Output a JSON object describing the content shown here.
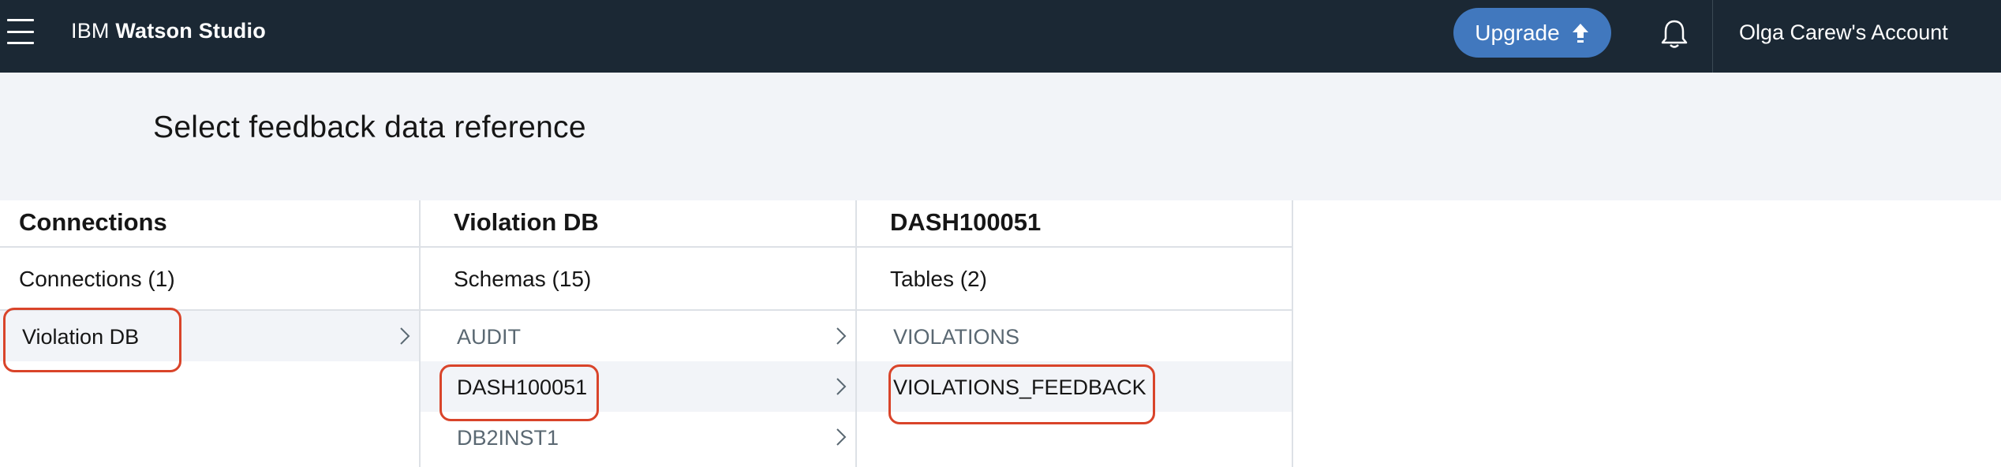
{
  "topbar": {
    "brand_prefix": "IBM",
    "brand_product": "Watson Studio",
    "upgrade_label": "Upgrade",
    "account_label": "Olga Carew's Account"
  },
  "header": {
    "title": "Select feedback data reference"
  },
  "columns": [
    {
      "title": "Connections",
      "subtitle": "Connections (1)",
      "items": [
        "Violation DB"
      ],
      "selected_index": 0
    },
    {
      "title": "Violation DB",
      "subtitle": "Schemas (15)",
      "items": [
        "AUDIT",
        "DASH100051",
        "DB2INST1"
      ],
      "selected_index": 1
    },
    {
      "title": "DASH100051",
      "subtitle": "Tables (2)",
      "items": [
        "VIOLATIONS",
        "VIOLATIONS_FEEDBACK"
      ],
      "selected_index": 1
    }
  ],
  "colors": {
    "topbar_bg": "#1b2834",
    "upgrade_bg": "#4178be",
    "header_bg": "#f2f4f8",
    "highlight_outline": "#d9442a"
  },
  "icons": [
    "menu-icon",
    "upload-arrow-icon",
    "bell-icon",
    "chevron-right-icon"
  ]
}
